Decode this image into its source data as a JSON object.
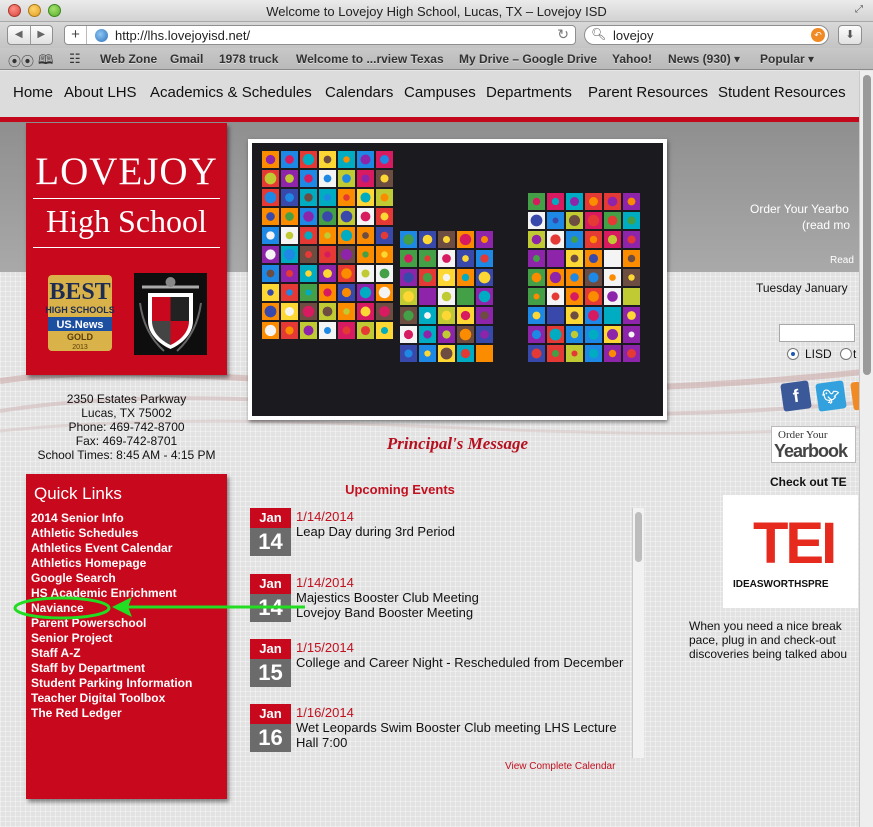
{
  "window": {
    "title": "Welcome to Lovejoy High School, Lucas, TX – Lovejoy ISD"
  },
  "toolbar": {
    "back_icon": "back-arrow-icon",
    "forward_icon": "forward-arrow-icon",
    "url": "http://lhs.lovejoyisd.net/",
    "search_query": "lovejoy"
  },
  "bookmarks": [
    "Web Zone",
    "Gmail",
    "1978 truck",
    "Welcome to ...rview Texas",
    "My Drive – Google Drive",
    "Yahoo!",
    "News (930) ▾",
    "Popular ▾"
  ],
  "site_nav": [
    "Home",
    "About LHS",
    "Academics & Schedules",
    "Calendars",
    "Campuses",
    "Departments",
    "Parent Resources",
    "Student Resources"
  ],
  "logo": {
    "line1": "LOVEJOY",
    "line2": "High School",
    "badge_best": "BEST",
    "badge_hs": "HIGH SCHOOLS",
    "badge_usnews": "US.News",
    "badge_gold": "GOLD",
    "badge_year": "2013"
  },
  "address": [
    "2350 Estates Parkway",
    "Lucas, TX 75002",
    "Phone: 469-742-8700",
    "Fax: 469-742-8701",
    "School Times: 8:45 AM - 4:15 PM"
  ],
  "quick_links": {
    "title": "Quick Links",
    "items": [
      "2014 Senior Info",
      "Athletic Schedules",
      "Athletics Event Calendar",
      "Athletics Homepage",
      "Google Search",
      "HS Academic Enrichment",
      "Naviance",
      "Parent Powerschool",
      "Senior Project",
      "Staff A-Z",
      "Staff by Department",
      "Student Parking Information",
      "Teacher Digital Toolbox",
      "The Red Ledger"
    ]
  },
  "principal_message": "Principal's Message",
  "events": {
    "title": "Upcoming Events",
    "items": [
      {
        "month": "Jan",
        "day": "14",
        "date": "1/14/2014",
        "lines": [
          "Leap Day during 3rd Period"
        ]
      },
      {
        "month": "Jan",
        "day": "14",
        "date": "1/14/2014",
        "lines": [
          "Majestics Booster Club Meeting",
          "Lovejoy Band Booster Meeting"
        ]
      },
      {
        "month": "Jan",
        "day": "15",
        "date": "1/15/2014",
        "lines": [
          "College and Career Night - Rescheduled from December"
        ]
      },
      {
        "month": "Jan",
        "day": "16",
        "date": "1/16/2014",
        "lines": [
          "Wet Leopards Swim Booster Club meeting LHS Lecture",
          "Hall 7:00"
        ]
      }
    ],
    "view_calendar": "View Complete Calendar"
  },
  "right": {
    "order_yearbook": "Order Your Yearbo",
    "read_more": "(read mo",
    "read": "Read",
    "date": "Tuesday January",
    "radio_lisd": "LISD",
    "radio_other": "t",
    "yearbook_small": "Order Your",
    "yearbook_big": "Yearbook",
    "check_out": "Check out TE",
    "ted_word": "TEI",
    "ted_tag": "IDEASWORTHSPRE",
    "desc": [
      "When you need a nice break",
      "pace, plug in and check-out",
      "discoveries being talked abou"
    ]
  },
  "social_icons": [
    "facebook-icon",
    "twitter-icon",
    "rss-icon"
  ],
  "colors": {
    "brand_red": "#c8081c",
    "annotation_green": "#22dd22",
    "event_red": "#c2101f"
  }
}
